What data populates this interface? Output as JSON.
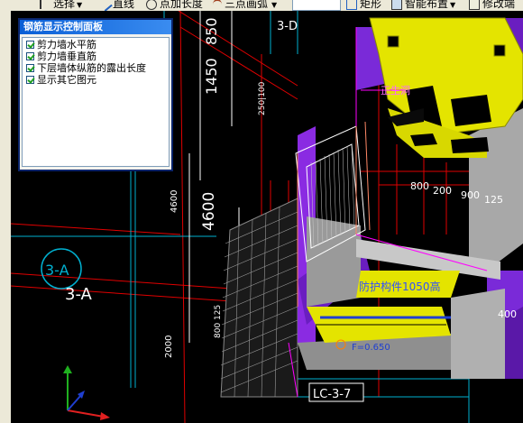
{
  "toolbar": {
    "items": [
      {
        "label": "选择",
        "icon": "select-arrow-icon"
      },
      {
        "label": "直线",
        "icon": "line-icon"
      },
      {
        "label": "点加长度",
        "icon": "point-plus-length-icon"
      },
      {
        "label": "三点画弧",
        "icon": "three-point-arc-icon"
      },
      {
        "label": "矩形",
        "icon": "rectangle-icon"
      },
      {
        "label": "智能布置",
        "icon": "smart-layout-icon"
      },
      {
        "label": "修改端",
        "icon": "modify-icon"
      }
    ]
  },
  "panel": {
    "title": "钢筋显示控制面板",
    "options": [
      {
        "label": "剪力墙水平筋",
        "checked": true
      },
      {
        "label": "剪力墙垂直筋",
        "checked": true
      },
      {
        "label": "下层墙体纵筋的露出长度",
        "checked": true
      },
      {
        "label": "显示其它图元",
        "checked": true
      }
    ]
  },
  "drawing": {
    "dims": {
      "d850": "850",
      "d1450": "1450",
      "d250100": "250|100",
      "d4600v": "4600",
      "d4600big": "4600",
      "d2000": "2000",
      "d800_125": "800 125",
      "d800": "800",
      "d200": "200",
      "d900": "900",
      "d125": "125",
      "d400": "400",
      "d3D": "3-D"
    },
    "axis_tag": "3-A",
    "axis_label": "3-A",
    "wall_tag": "LC-3-7",
    "beam_text": "防护构件1050高",
    "f_label": "F=0.650",
    "ghost_label": "正生洞",
    "colors": {
      "yellow": "#e4e400",
      "purple": "#8a2be2",
      "gray": "#a8a8a8",
      "red_grid": "#e00000",
      "cyan_grid": "#00b0d0",
      "magenta": "#ff00ff"
    }
  }
}
